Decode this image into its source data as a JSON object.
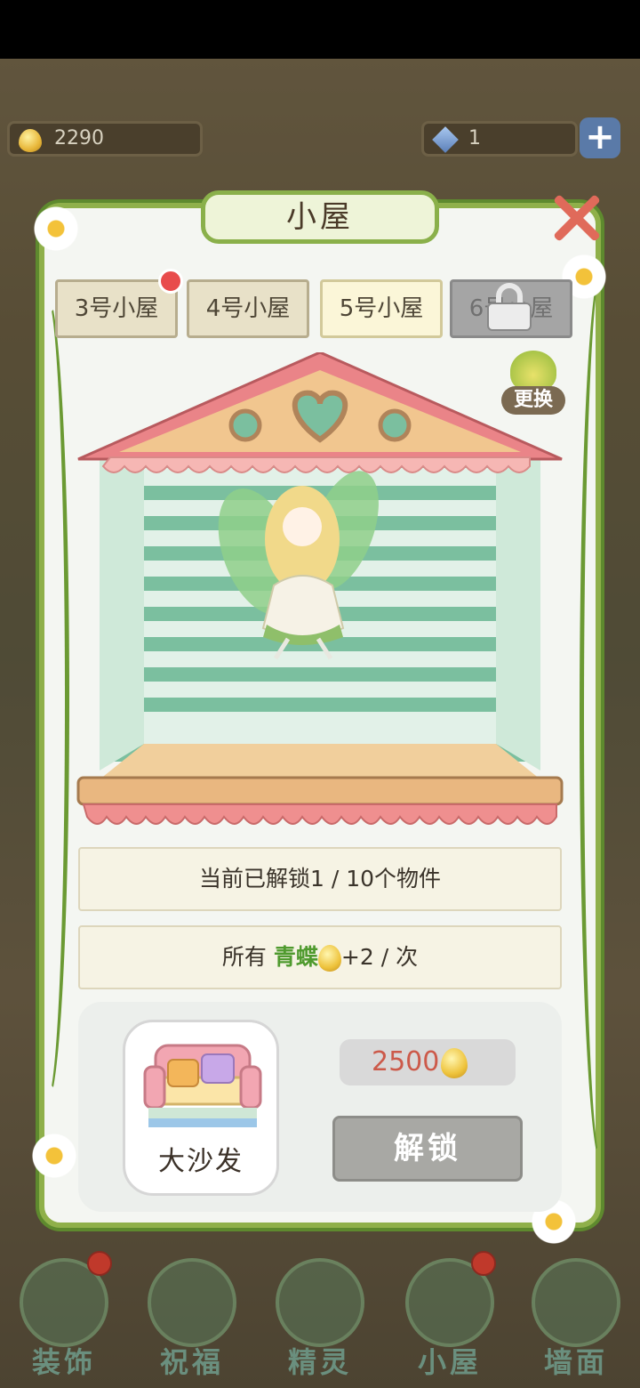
{
  "currencies": {
    "coins": "2290",
    "gems": "1"
  },
  "dialog": {
    "title": "小屋",
    "tabs": [
      "3号小屋",
      "4号小屋",
      "5号小屋",
      "6号小屋"
    ],
    "change_label": "更换"
  },
  "info": {
    "unlock_progress": "当前已解锁1 / 10个物件",
    "bonus_prefix": "所有",
    "bonus_highlight": "青蝶",
    "bonus_suffix": "+2 / 次"
  },
  "item": {
    "name": "大沙发",
    "price": "2500",
    "unlock_label": "解锁"
  },
  "nav": [
    "装饰",
    "祝福",
    "精灵",
    "小屋",
    "墙面"
  ],
  "colors": {
    "panel_border": "#8fb04a",
    "price_text": "#cc5a4a",
    "highlight_green": "#4f9a2e",
    "notification": "#e84c4c"
  }
}
